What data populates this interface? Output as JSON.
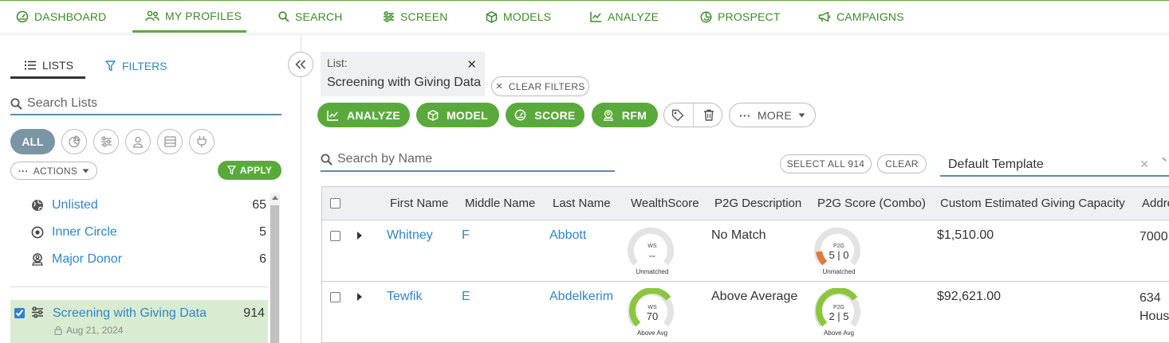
{
  "nav": {
    "items": [
      {
        "label": "DASHBOARD",
        "icon": "dashboard-gauge-icon"
      },
      {
        "label": "MY PROFILES",
        "icon": "people-icon",
        "active": true
      },
      {
        "label": "SEARCH",
        "icon": "search-icon"
      },
      {
        "label": "SCREEN",
        "icon": "sliders-icon"
      },
      {
        "label": "MODELS",
        "icon": "cube-icon"
      },
      {
        "label": "ANALYZE",
        "icon": "line-chart-icon"
      },
      {
        "label": "PROSPECT",
        "icon": "prospect-icon"
      },
      {
        "label": "CAMPAIGNS",
        "icon": "megaphone-icon"
      }
    ],
    "accent": "#5aaa3b"
  },
  "sidebar": {
    "tabs": {
      "lists": "LISTS",
      "filters": "FILTERS"
    },
    "search_placeholder": "Search Lists",
    "filter_all": "ALL",
    "actions_label": "ACTIONS",
    "apply_label": "APPLY",
    "lists": [
      {
        "name": "Unlisted",
        "count": "65",
        "icon": "globe-icon"
      },
      {
        "name": "Inner Circle",
        "count": "5",
        "icon": "target-circle-icon"
      },
      {
        "name": "Major Donor",
        "count": "6",
        "icon": "donor-icon"
      }
    ],
    "selected_list": {
      "name": "Screening with Giving Data",
      "count": "914",
      "date": "Aug 21, 2024",
      "checked": true
    }
  },
  "main": {
    "list_chip": {
      "label": "List:",
      "value": "Screening with Giving Data"
    },
    "clear_filters": "CLEAR FILTERS",
    "action_buttons": [
      "ANALYZE",
      "MODEL",
      "SCORE",
      "RFM"
    ],
    "more_label": "MORE",
    "search_placeholder": "Search by Name",
    "select_all": "SELECT ALL 914",
    "clear": "CLEAR",
    "template": "Default Template"
  },
  "table": {
    "columns": [
      "First Name",
      "Middle Name",
      "Last Name",
      "WealthScore",
      "P2G Description",
      "P2G Score (Combo)",
      "Custom Estimated Giving Capacity",
      "Addre"
    ],
    "rows": [
      {
        "first": "Whitney",
        "middle": "F",
        "last": "Abbott",
        "ws": {
          "title": "WS",
          "value": "--",
          "caption": "Unmatched",
          "level": 0
        },
        "p2g_desc": "No Match",
        "p2g": {
          "title": "P2G",
          "value": "5 | 0",
          "caption": "Unmatched",
          "level": 0.14
        },
        "capacity": "$1,510.00",
        "address": [
          "7000"
        ]
      },
      {
        "first": "Tewfik",
        "middle": "E",
        "last": "Abdelkerim",
        "ws": {
          "title": "WS",
          "value": "70",
          "caption": "Above Avg",
          "level": 0.7
        },
        "p2g_desc": "Above Average",
        "p2g": {
          "title": "P2G",
          "value": "2 | 5",
          "caption": "Above Avg",
          "level": 0.7
        },
        "capacity": "$92,621.00",
        "address": [
          "634",
          "Hous"
        ]
      }
    ]
  }
}
